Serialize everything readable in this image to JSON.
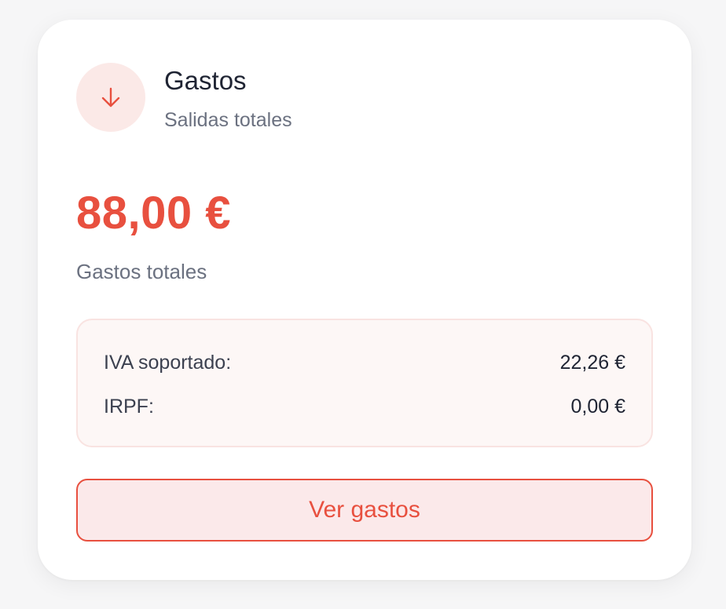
{
  "header": {
    "icon": "arrow-down-icon",
    "title": "Gastos",
    "subtitle": "Salidas totales"
  },
  "summary": {
    "amount": "88,00 €",
    "label": "Gastos totales"
  },
  "breakdown": {
    "rows": [
      {
        "label": "IVA soportado:",
        "value": "22,26 €"
      },
      {
        "label": "IRPF:",
        "value": "0,00 €"
      }
    ]
  },
  "actions": {
    "view_label": "Ver gastos"
  },
  "colors": {
    "accent": "#e8503f",
    "accent_bg": "#fbe9e7",
    "card_bg": "#ffffff",
    "page_bg": "#f6f6f7"
  }
}
